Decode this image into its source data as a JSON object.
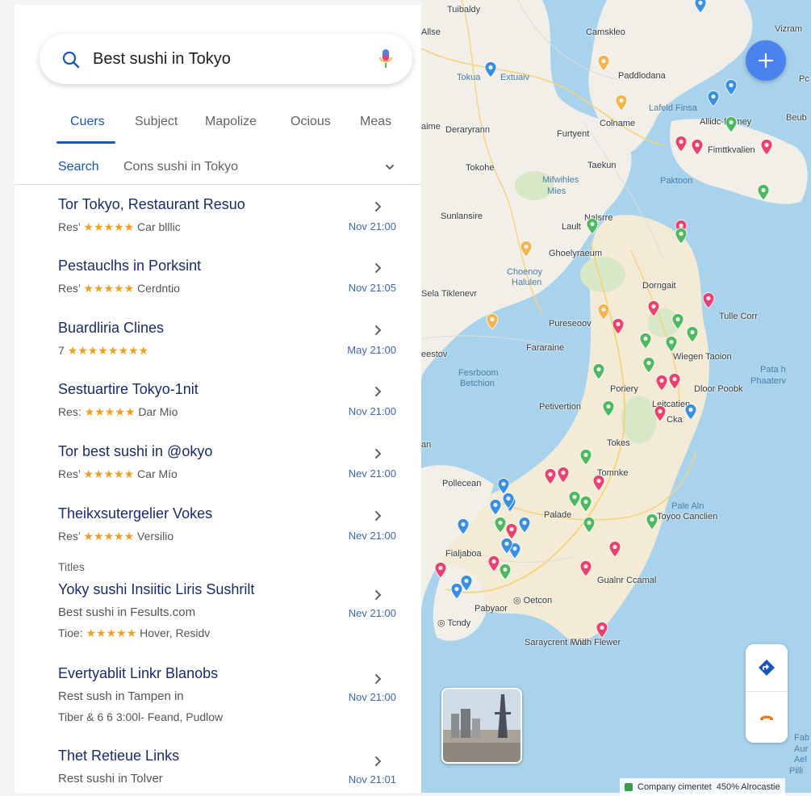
{
  "search": {
    "query": "Best sushi in Tokyo"
  },
  "tabs": [
    {
      "label": "Cuers",
      "active": true
    },
    {
      "label": "Subject"
    },
    {
      "label": "Mapolize"
    },
    {
      "label": "Ocious"
    },
    {
      "label": "Meas"
    }
  ],
  "subbar": {
    "label": "Search",
    "query": "Cons sushi in Tokyo"
  },
  "results": [
    {
      "title": "Tor Tokyo, Restaurant Resuo",
      "prefix": "Res’",
      "stars": "★★★★★",
      "suffix": "Car blllic",
      "time": "Nov 21:00"
    },
    {
      "title": "Pestauclhs in Porksint",
      "prefix": "Res’",
      "stars": "★★★★★",
      "suffix": "Cerdntio",
      "time": "Nov 21:05"
    },
    {
      "title": "Buardliria Clines",
      "prefix": "7",
      "stars": "★★★★★★★★",
      "suffix": "",
      "time": "May 21:00"
    },
    {
      "title": "Sestuartire Tokyo-1nit",
      "prefix": "Res:",
      "stars": "★★★★★",
      "suffix": "Dar Mio",
      "time": "Nov 21:00"
    },
    {
      "title": "Tor best sushi in @okyo",
      "prefix": "Res’",
      "stars": "★★★★★",
      "suffix": "Car Mío",
      "time": "Nev 21:00"
    },
    {
      "title": "Theikxsutergelier Vokes",
      "prefix": "Res’",
      "stars": "★★★★★",
      "suffix": "Versilio",
      "time": "Nev 21:00"
    }
  ],
  "section_label": "Titles",
  "results2": [
    {
      "title": "Yoky sushi Insiitic Liris Sushrilt",
      "line1": "Best sushi in Fesults.com",
      "prefix": "Tioe:",
      "stars": "★★★★★",
      "suffix": "Hover, Residv",
      "time": "Nev 21:00"
    },
    {
      "title": "Evertyablit Linkr Blanobs",
      "line1": "Rest sush in Tampen in",
      "line2": "Tiber & 6 6 3:00l- Feand, Pudlow",
      "time": "Nov 21:00"
    },
    {
      "title": "Thet Retieue Links",
      "line1": "Rest sushi in Tolver",
      "time": "Nov 21:01"
    }
  ],
  "map": {
    "places": [
      {
        "text": "Tuibaldy",
        "cls": ""
      },
      {
        "text": "Allse",
        "cls": "bold"
      },
      {
        "text": "Camskleo",
        "cls": "bold"
      },
      {
        "text": "Vizram",
        "cls": ""
      },
      {
        "text": "Tokua",
        "cls": "sea"
      },
      {
        "text": "Extuaiv",
        "cls": "sea"
      },
      {
        "text": "Paddlodana",
        "cls": "bold"
      },
      {
        "text": "Lafeld Finsa",
        "cls": "sea"
      },
      {
        "text": "Allidc-Pomey",
        "cls": "bold"
      },
      {
        "text": "Beub",
        "cls": ""
      },
      {
        "text": "aime",
        "cls": ""
      },
      {
        "text": "Deraryrann",
        "cls": "bold"
      },
      {
        "text": "Colname",
        "cls": "bold"
      },
      {
        "text": "Furtyent",
        "cls": "bold"
      },
      {
        "text": "Fimttkvalien",
        "cls": "bold"
      },
      {
        "text": "Tokohe",
        "cls": "bold"
      },
      {
        "text": "Taekun",
        "cls": "bold"
      },
      {
        "text": "Paktoon",
        "cls": "sea"
      },
      {
        "text": "Mifwihles",
        "cls": "sea"
      },
      {
        "text": "Mies",
        "cls": "sea"
      },
      {
        "text": "Sunlansire",
        "cls": "bold"
      },
      {
        "text": "Nalsrre",
        "cls": "bold"
      },
      {
        "text": "Lault",
        "cls": "bold"
      },
      {
        "text": "Ghoelyraeum",
        "cls": "bold"
      },
      {
        "text": "Choenoy",
        "cls": "sea"
      },
      {
        "text": "Halulen",
        "cls": "sea"
      },
      {
        "text": "Dorngait",
        "cls": "bold"
      },
      {
        "text": "Sela Tiklenevr",
        "cls": ""
      },
      {
        "text": "Tulle Corr",
        "cls": "bold"
      },
      {
        "text": "Pureseoov",
        "cls": "bold"
      },
      {
        "text": "Fararaine",
        "cls": "bold"
      },
      {
        "text": "Wiegen Taoion",
        "cls": "bold"
      },
      {
        "text": "eestov",
        "cls": ""
      },
      {
        "text": "Pata h",
        "cls": "sea"
      },
      {
        "text": "Phaaterv",
        "cls": "sea"
      },
      {
        "text": "Fesrboom",
        "cls": "sea"
      },
      {
        "text": "Betchion",
        "cls": "sea"
      },
      {
        "text": "Poriery",
        "cls": "bold"
      },
      {
        "text": "Dloor Poobk",
        "cls": "bold"
      },
      {
        "text": "Petivertion",
        "cls": "bold"
      },
      {
        "text": "Leitcatien",
        "cls": "bold"
      },
      {
        "text": "Cka",
        "cls": "bold"
      },
      {
        "text": "Tokes",
        "cls": "bold"
      },
      {
        "text": "an",
        "cls": ""
      },
      {
        "text": "Tomnke",
        "cls": "bold"
      },
      {
        "text": "Pollecean",
        "cls": "bold"
      },
      {
        "text": "Palade",
        "cls": "bold"
      },
      {
        "text": "Pale Aln",
        "cls": "sea"
      },
      {
        "text": "Toyoo Canclien",
        "cls": "bold"
      },
      {
        "text": "Fialjaboa",
        "cls": "bold"
      },
      {
        "text": "Gualnr Ccamal",
        "cls": "bold"
      },
      {
        "text": "◎ Oetcon",
        "cls": "bold"
      },
      {
        "text": "Pabyaor",
        "cls": "bold"
      },
      {
        "text": "◎ Tcndy",
        "cls": "bold"
      },
      {
        "text": "Saraycrent Fink.",
        "cls": "bold"
      },
      {
        "text": "Widh Flewer",
        "cls": "bold"
      },
      {
        "text": "Fab",
        "cls": "sea"
      },
      {
        "text": "Aur",
        "cls": "sea"
      },
      {
        "text": "Ael",
        "cls": "sea"
      },
      {
        "text": "Pilli",
        "cls": "sea"
      },
      {
        "text": "Pc",
        "cls": ""
      }
    ],
    "attribution": "Company cimentet",
    "attribution2": "450% Alrocastie",
    "colors": {
      "red": "#e8436f",
      "green": "#4fb860",
      "blue": "#3b8fe0",
      "orange": "#f3b34d",
      "accent": "#4a83ee"
    }
  }
}
